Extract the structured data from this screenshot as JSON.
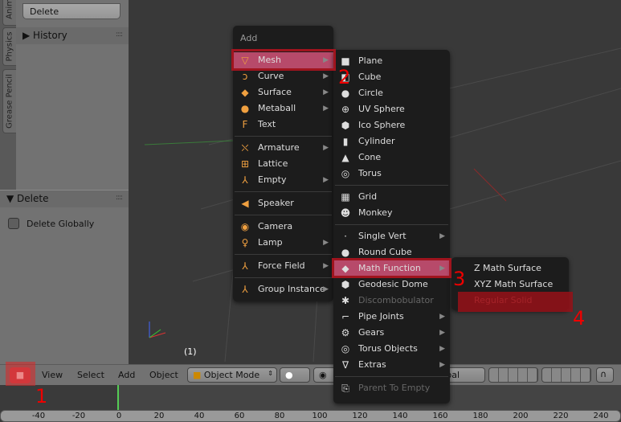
{
  "left_panel": {
    "tabs": [
      "Anim",
      "Physics",
      "Grease Pencil"
    ],
    "delete_button": "Delete",
    "history_header": "History",
    "delete_panel_header": "Delete",
    "delete_globally": {
      "label": "Delete Globally",
      "checked": false
    }
  },
  "viewport": {
    "frame_label": "(1)"
  },
  "header": {
    "menus": [
      "View",
      "Select",
      "Add",
      "Object"
    ],
    "mode": "Object Mode",
    "orientation": "Global"
  },
  "timeline": {
    "ticks": [
      "-40",
      "-20",
      "0",
      "20",
      "40",
      "60",
      "80",
      "100",
      "120",
      "140",
      "160",
      "180",
      "200",
      "220",
      "240"
    ],
    "current_frame": 0
  },
  "add_menu": {
    "title": "Add",
    "items": [
      {
        "label": "Mesh",
        "icon": "mesh-icon",
        "glyph": "▽",
        "submenu": true,
        "highlighted": true
      },
      {
        "label": "Curve",
        "icon": "curve-icon",
        "glyph": "ↄ",
        "submenu": true
      },
      {
        "label": "Surface",
        "icon": "surface-icon",
        "glyph": "◆",
        "submenu": true
      },
      {
        "label": "Metaball",
        "icon": "metaball-icon",
        "glyph": "●",
        "submenu": true
      },
      {
        "label": "Text",
        "icon": "text-icon",
        "glyph": "F"
      },
      {
        "label": "Armature",
        "icon": "armature-icon",
        "glyph": "⛌",
        "submenu": true,
        "sep": true
      },
      {
        "label": "Lattice",
        "icon": "lattice-icon",
        "glyph": "⊞"
      },
      {
        "label": "Empty",
        "icon": "empty-icon",
        "glyph": "⅄",
        "submenu": true
      },
      {
        "label": "Speaker",
        "icon": "speaker-icon",
        "glyph": "◀",
        "sep": true
      },
      {
        "label": "Camera",
        "icon": "camera-icon",
        "glyph": "◉",
        "sep": true
      },
      {
        "label": "Lamp",
        "icon": "lamp-icon",
        "glyph": "♀",
        "submenu": true
      },
      {
        "label": "Force Field",
        "icon": "force-field-icon",
        "glyph": "⅄",
        "submenu": true,
        "sep": true
      },
      {
        "label": "Group Instance",
        "icon": "group-instance-icon",
        "glyph": "⅄",
        "submenu": true,
        "sep": true
      }
    ]
  },
  "mesh_menu": {
    "items": [
      {
        "label": "Plane",
        "icon": "plane-icon",
        "glyph": "■"
      },
      {
        "label": "Cube",
        "icon": "cube-icon",
        "glyph": "◧"
      },
      {
        "label": "Circle",
        "icon": "circle-icon",
        "glyph": "●"
      },
      {
        "label": "UV Sphere",
        "icon": "uv-sphere-icon",
        "glyph": "⊕"
      },
      {
        "label": "Ico Sphere",
        "icon": "ico-sphere-icon",
        "glyph": "⬢"
      },
      {
        "label": "Cylinder",
        "icon": "cylinder-icon",
        "glyph": "▮"
      },
      {
        "label": "Cone",
        "icon": "cone-icon",
        "glyph": "▲"
      },
      {
        "label": "Torus",
        "icon": "torus-icon",
        "glyph": "◎"
      },
      {
        "label": "Grid",
        "icon": "grid-icon",
        "glyph": "▦",
        "sep": true
      },
      {
        "label": "Monkey",
        "icon": "monkey-icon",
        "glyph": "☻"
      },
      {
        "label": "Single Vert",
        "icon": "vertex-icon",
        "glyph": "·",
        "submenu": true,
        "sep": true
      },
      {
        "label": "Round Cube",
        "icon": "round-cube-icon",
        "glyph": "●"
      },
      {
        "label": "Math Function",
        "icon": "math-function-icon",
        "glyph": "◆",
        "submenu": true,
        "highlighted": true
      },
      {
        "label": "Geodesic Dome",
        "icon": "geodesic-dome-icon",
        "glyph": "⬢"
      },
      {
        "label": "Discombobulator",
        "icon": "discombobulator-icon",
        "glyph": "✱",
        "disabled": true
      },
      {
        "label": "Pipe Joints",
        "icon": "pipe-joints-icon",
        "glyph": "⌐",
        "submenu": true
      },
      {
        "label": "Gears",
        "icon": "gears-icon",
        "glyph": "⚙",
        "submenu": true
      },
      {
        "label": "Torus Objects",
        "icon": "torus-objects-icon",
        "glyph": "◎",
        "submenu": true
      },
      {
        "label": "Extras",
        "icon": "extras-icon",
        "glyph": "∇",
        "submenu": true
      },
      {
        "label": "Parent To Empty",
        "icon": "parent-to-empty-icon",
        "glyph": "⎘",
        "disabled": true,
        "sep": true
      }
    ]
  },
  "math_menu": {
    "items": [
      {
        "label": "Z Math Surface"
      },
      {
        "label": "XYZ Math Surface"
      },
      {
        "label": "Regular Solid",
        "highlighted": true
      }
    ]
  },
  "annotations": [
    "1",
    "2",
    "3",
    "4"
  ],
  "colors": {
    "highlight": "#b74a6a",
    "annotation": "#e00000",
    "selected": "#8c1018"
  }
}
